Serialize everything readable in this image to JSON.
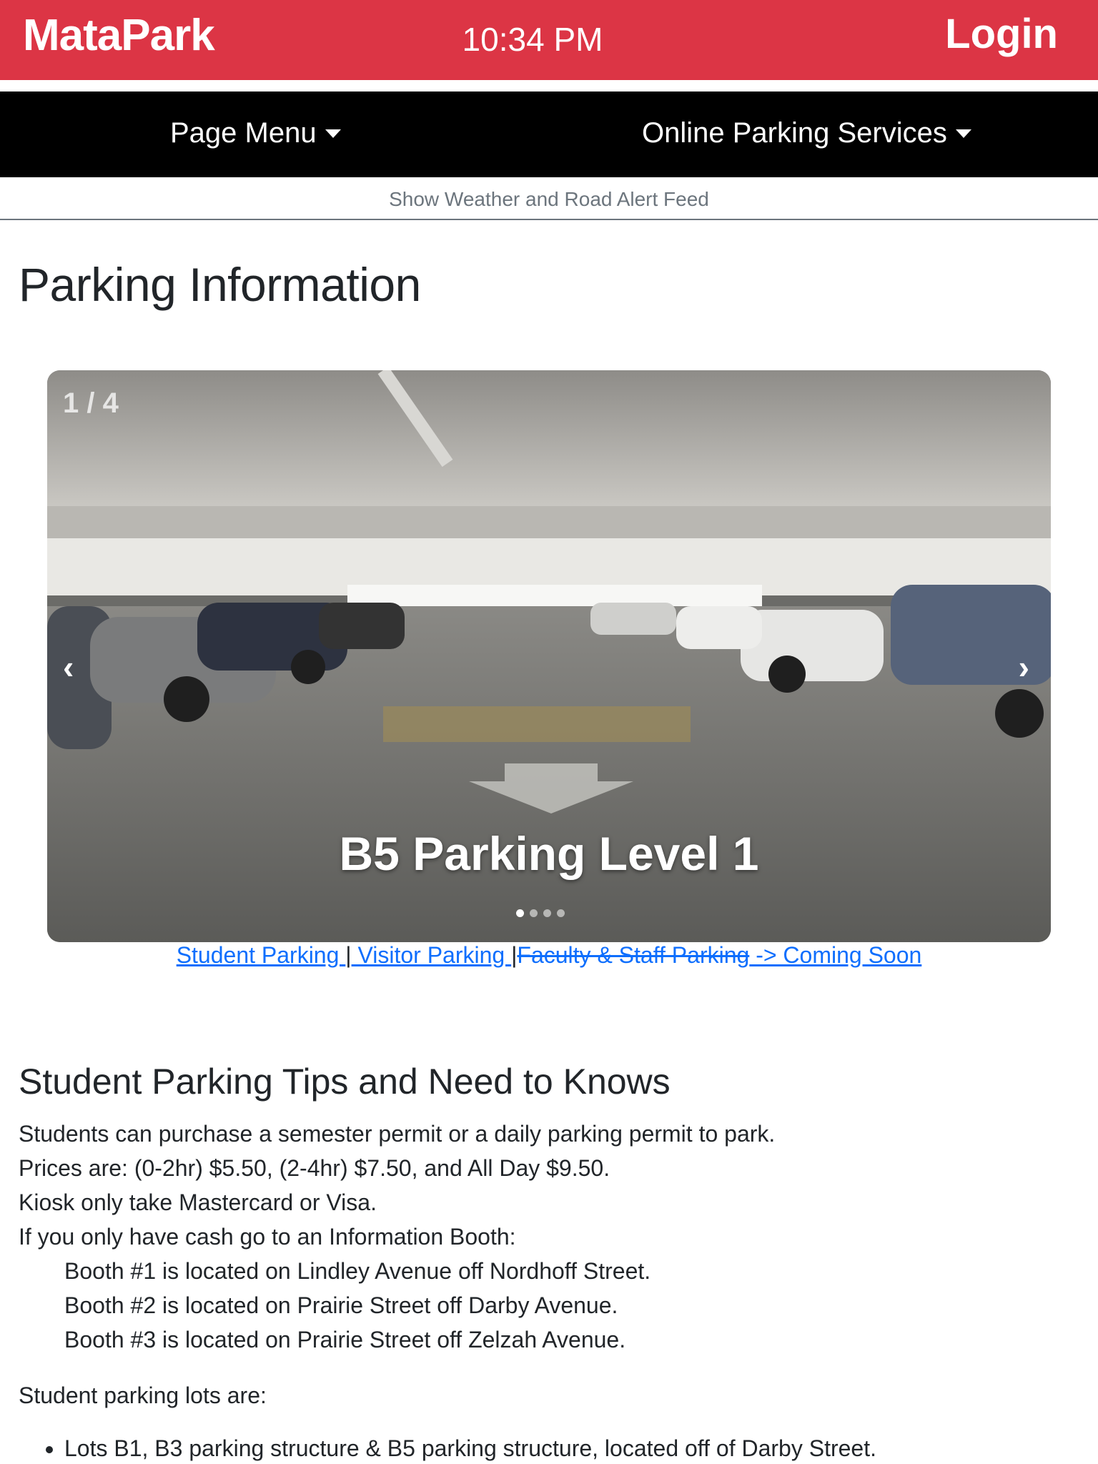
{
  "header": {
    "brand": "MataPark",
    "time": "10:34 PM",
    "login_label": "Login",
    "accent_color": "#dc3545"
  },
  "nav": {
    "page_menu_label": "Page Menu",
    "online_services_label": "Online Parking Services",
    "caret_icon": "caret-down-icon"
  },
  "alert_feed": {
    "label": "Show Weather and Road Alert Feed"
  },
  "page": {
    "title": "Parking Information"
  },
  "carousel": {
    "counter": "1 / 4",
    "caption": "B5 Parking Level 1",
    "prev_icon": "‹",
    "next_icon": "›",
    "total_slides": 4,
    "active_slide": 1
  },
  "links": {
    "student": "Student Parking ",
    "sep1": "|",
    "visitor": " Visitor Parking ",
    "sep2": "|",
    "faculty": "Faculty & Staff Parking",
    "coming_soon": " -> Coming Soon"
  },
  "student_section": {
    "title": "Student Parking Tips and Need to Knows",
    "lines": [
      "Students can purchase a semester permit or a daily parking permit to park.",
      "Prices are: (0-2hr) $5.50, (2-4hr) $7.50, and All Day $9.50.",
      "Kiosk only take Mastercard or Visa.",
      "If you only have cash go to an Information Booth:"
    ],
    "booths": [
      "Booth #1 is located on Lindley Avenue off Nordhoff Street.",
      "Booth #2 is located on Prairie Street off Darby Avenue.",
      "Booth #3 is located on Prairie Street off Zelzah Avenue."
    ],
    "lots_label": "Student parking lots are:",
    "lots": [
      "Lots B1, B3 parking structure & B5 parking structure, located off of Darby Street."
    ]
  }
}
